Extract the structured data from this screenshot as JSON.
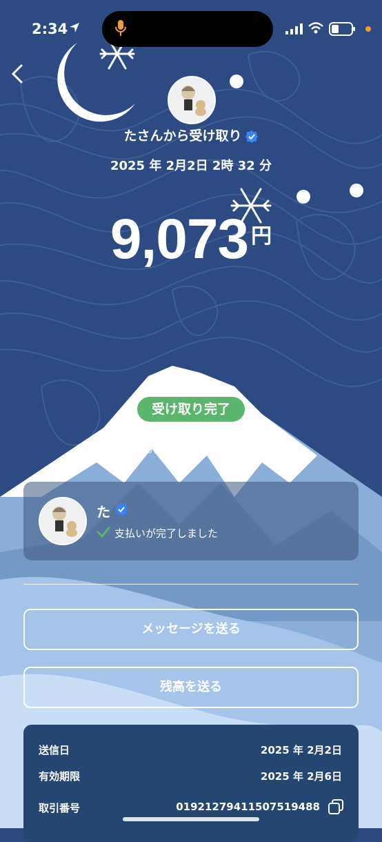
{
  "status_bar": {
    "time": "2:34",
    "icons": [
      "location-arrow-icon",
      "microphone-icon",
      "cellular-signal-icon",
      "wifi-icon",
      "battery-icon"
    ]
  },
  "header": {
    "back_icon": "chevron-left-icon",
    "sender_label": "たさんから受け取り",
    "received_datetime": "2025 年 2月2日 2時 32 分"
  },
  "amount": {
    "value": "9,073",
    "unit": "円"
  },
  "status": {
    "badge": "受け取り完了",
    "completion_line": "取引完了                            日 2時 34 分"
  },
  "message_card": {
    "name": "た",
    "status_text": "支払いが完了しました"
  },
  "actions": {
    "send_message": "メッセージを送る",
    "send_balance": "残高を送る"
  },
  "info": {
    "sent_date_label": "送信日",
    "sent_date_value": "2025 年 2月2日",
    "expiry_label": "有効期限",
    "expiry_value": "2025 年 2月6日",
    "transaction_label": "取引番号",
    "transaction_value": "01921279411507519488"
  },
  "colors": {
    "background_navy": "#2c4a80",
    "badge_green": "#5bb56c",
    "verified_blue": "#3b82f6",
    "info_card": "#264672"
  }
}
